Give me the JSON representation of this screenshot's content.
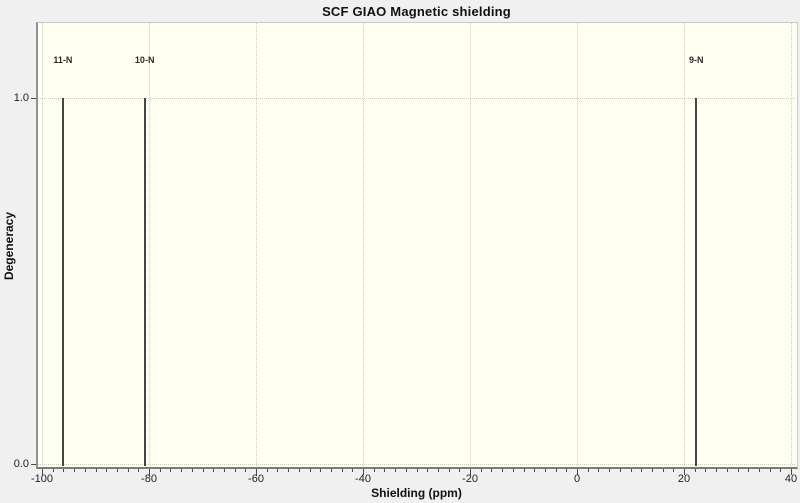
{
  "window": {
    "background_color": "#f0f0f0",
    "plot_background_color": "#fffff2"
  },
  "chart_data": {
    "type": "bar",
    "subtype": "stem-spectrum",
    "title": "SCF GIAO Magnetic shielding",
    "xlabel": "Shielding (ppm)",
    "ylabel": "Degeneracy",
    "xlim": [
      -101.2,
      41.2
    ],
    "ylim": [
      0,
      1.21
    ],
    "x_major_ticks": [
      -100,
      -80,
      -60,
      -40,
      -20,
      0,
      20,
      40
    ],
    "x_tick_labels": [
      "-100",
      "-80",
      "-60",
      "-40",
      "-20",
      "0",
      "20",
      "40"
    ],
    "x_minor_tick_step": 2,
    "y_ticks": [
      0.0,
      1.0
    ],
    "y_tick_labels": [
      "0.0",
      "1.0"
    ],
    "grid": {
      "style": "dotted",
      "vertical_at_x_major_ticks": true,
      "horizontal_at_y_ticks": true
    },
    "legend_position": "none",
    "peaks": [
      {
        "label": "11-N",
        "shielding_ppm": -96.1,
        "degeneracy": 1.0
      },
      {
        "label": "10-N",
        "shielding_ppm": -80.8,
        "degeneracy": 1.0
      },
      {
        "label": "9-N",
        "shielding_ppm": 22.3,
        "degeneracy": 1.0
      }
    ]
  },
  "colors": {
    "grid_dotted": "#ccccc2",
    "peak_line": "#454545",
    "tick_mark": "#4a4a4a",
    "tick_label_text": "#222222",
    "title_text": "#111111",
    "axis_border_left": "#919191",
    "axis_border_bottom": "#7a7a7a",
    "axis_border_light": "#c9c9c9"
  }
}
